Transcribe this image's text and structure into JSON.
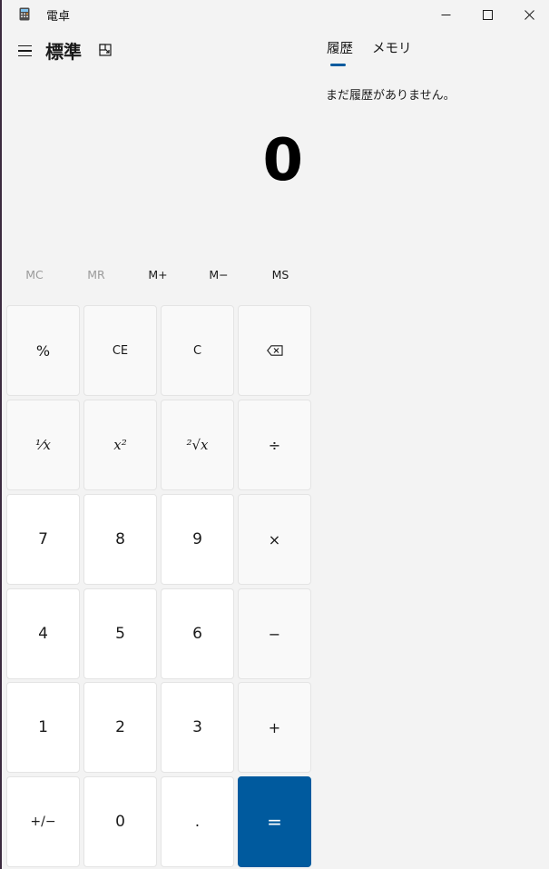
{
  "window": {
    "title": "電卓",
    "controls": [
      "minimize",
      "maximize",
      "close"
    ]
  },
  "header": {
    "mode_title": "標準",
    "menu_icon": "hamburger-icon",
    "keep_on_top_icon": "keep-on-top-icon"
  },
  "display": {
    "value": "0"
  },
  "memory": [
    {
      "label": "MC",
      "enabled": false
    },
    {
      "label": "MR",
      "enabled": false
    },
    {
      "label": "M+",
      "enabled": true
    },
    {
      "label": "M−",
      "enabled": true
    },
    {
      "label": "MS",
      "enabled": true
    }
  ],
  "keypad": {
    "percent": "%",
    "clear_entry": "CE",
    "clear": "C",
    "backspace_icon": "backspace-icon",
    "reciprocal": "¹⁄x",
    "square": "x²",
    "square_root": "²√x",
    "divide": "÷",
    "seven": "7",
    "eight": "8",
    "nine": "9",
    "multiply": "×",
    "four": "4",
    "five": "5",
    "six": "6",
    "subtract": "−",
    "one": "1",
    "two": "2",
    "three": "3",
    "add": "+",
    "negate": "+/−",
    "zero": "0",
    "decimal": ".",
    "equals": "="
  },
  "history_panel": {
    "tabs": [
      {
        "label": "履歴",
        "selected": true
      },
      {
        "label": "メモリ",
        "selected": false
      }
    ],
    "empty_message": "まだ履歴がありません。"
  },
  "colors": {
    "background": "#f3f3f3",
    "accent": "#005a9e",
    "number_key": "#ffffff",
    "function_key": "#f9f9f9",
    "disabled_text": "#9a9a9a"
  }
}
